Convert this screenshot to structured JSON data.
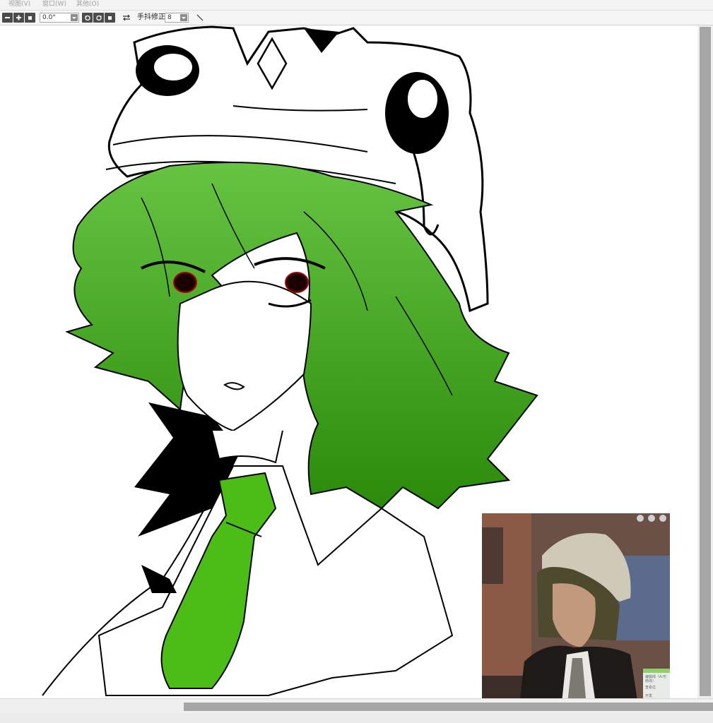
{
  "menu": {
    "items": [
      {
        "label": "视图(V)"
      },
      {
        "label": "窗口(W)"
      },
      {
        "label": "其他(O)"
      }
    ]
  },
  "toolbar": {
    "rotation_value": "0.0°",
    "stabilizer_label": "手抖修正",
    "stabilizer_value": "8"
  },
  "reference": {
    "panel_title": "编辑线（A:可修改）",
    "panel_rows": [
      "查看位",
      "开发",
      "位"
    ]
  },
  "colors": {
    "hair_light": "#5fbf3a",
    "hair_dark": "#2b8a0a",
    "tie": "#4cbd17",
    "ink": "#000000",
    "toolbar_button": "#4b4b4b",
    "scrollbar_thumb": "#a6a6a6"
  },
  "icons": {
    "zoom_out": "minus-icon",
    "zoom_in": "plus-icon",
    "fit": "square-icon",
    "rotate_left": "rotate-left-icon",
    "rotate_right": "rotate-right-icon",
    "reset": "square-icon",
    "flip": "flip-horizontal-icon",
    "line_tool": "straight-line-icon"
  }
}
